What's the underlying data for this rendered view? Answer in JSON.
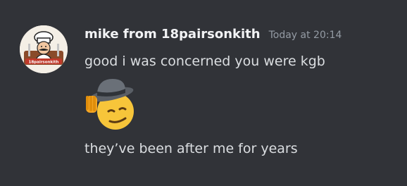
{
  "message": {
    "author": "mike from 18pairsonkith",
    "timestamp": "Today at 20:14",
    "avatar_text": "18pairsonkith",
    "lines": [
      "good i was concerned you were kgb",
      "they’ve been after me for years"
    ],
    "emoji": "saluting-face-with-hat-icon"
  },
  "colors": {
    "background": "#313338",
    "username": "#f2f3f5",
    "timestamp": "#949ba4",
    "text": "#dbdee1"
  }
}
